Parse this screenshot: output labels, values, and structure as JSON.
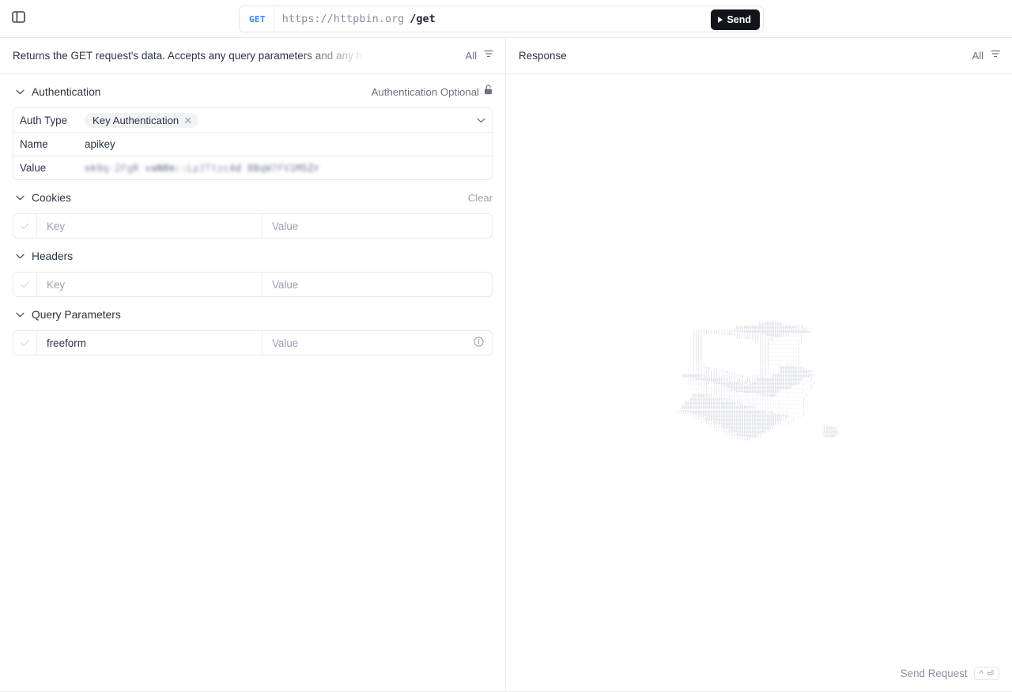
{
  "topbar": {
    "sidebar_toggle_icon": "panel-toggle-icon",
    "method": "GET",
    "url_base": "https://httpbin.org",
    "url_path": "/get",
    "send_label": "Send"
  },
  "request_pane": {
    "description": "Returns the GET request's data. Accepts any query parameters and any h",
    "filter_label": "All",
    "filter_icon": "filter-icon",
    "sections": {
      "authentication": {
        "title": "Authentication",
        "chevron": "chevron-down-icon",
        "status_label": "Authentication Optional",
        "status_icon": "unlock-icon",
        "rows": [
          {
            "label": "Auth Type",
            "value": "Key Authentication",
            "remove_icon": "close-icon",
            "dropdown_icon": "chevron-down-icon"
          },
          {
            "label": "Name",
            "value": "apikey"
          },
          {
            "label": "Value",
            "value": "••••••••••••••••••••••••••••",
            "redacted": true
          }
        ]
      },
      "cookies": {
        "title": "Cookies",
        "chevron": "chevron-down-icon",
        "clear_label": "Clear",
        "rows": [
          {
            "checked_icon": "check-icon",
            "key": "",
            "key_placeholder": "Key",
            "value": "",
            "value_placeholder": "Value"
          }
        ]
      },
      "headers": {
        "title": "Headers",
        "chevron": "chevron-down-icon",
        "rows": [
          {
            "checked_icon": "check-icon",
            "key": "",
            "key_placeholder": "Key",
            "value": "",
            "value_placeholder": "Value"
          }
        ]
      },
      "query_parameters": {
        "title": "Query Parameters",
        "chevron": "chevron-down-icon",
        "rows": [
          {
            "checked_icon": "check-icon",
            "key": "freeform",
            "key_placeholder": "Key",
            "value": "",
            "value_placeholder": "Value",
            "info_icon": "info-icon"
          }
        ]
      }
    }
  },
  "response_pane": {
    "title": "Response",
    "filter_label": "All",
    "filter_icon": "filter-icon",
    "placeholder_art": "                             ..,UodB8Bbou,,.\n                    ..,UodBB8888888888888888bPFT?Li:.\n      |||||||||||||||!?TFPd8888888888888888888888Bm=,\n      ||||      ''''^^!|||||||||||TFP888VT!!:...|\n      ||||             ''''^^!||||||?|:.........|\n      ||||                      ||||...........|\n      ||||                      ||||...........|\n      ||||                      ||||...........|\n      ||||                      ||||...........|\n      ||||                      ||||...........|\n      ||||,                     ||||...........|\n      ||||!!=.,,                ||||....88888Bbou,.\n      ':||||||||!!:=.,,         ||||....88888888888Y!\n  888888Bbfol!|||||||||!!=..,::|||!..888888888888888Y!\n   ::|?TFP8888888bfol!||||||||!88888888888888888Y...!\n    ::::||||!?TFP8888888bAfLaaB8888888888888888Y.....!\n     ....::::||||!?TFP8888888888888888888888Y.......!\n       ...::::||||!!?TTFFP8888888888888Y.........!\n     .Do8Bbfol:::::::::::::::::!?TFP8BY...........!\n    .888888888888bfol:::::::::::::::::...........!\n  .8888888888888888888bfol::::::::::::::.........!\n .8888888888888888888888888bfol:::::::::::.......!\n!?TFP98888888888888888888888888888bfoL:::::......!\n   '''!!TFP98888888888888888888888888888bfoL::...!\n      '''!!TFP98888888888888888888888888Y!!..!\n         '''!!TFP988888888888888888888Y!!..!\n            '''!!TFP9888888888888888Y!                   I88bo.\n               '''!!TFP98888888888Y!                     88888o.\n                  '''!!TFP98888Y!                        Y888P''\n                       '''!!'",
    "send_request_label": "Send Request",
    "shortcut_modifier": "^",
    "shortcut_key": "⏎"
  }
}
